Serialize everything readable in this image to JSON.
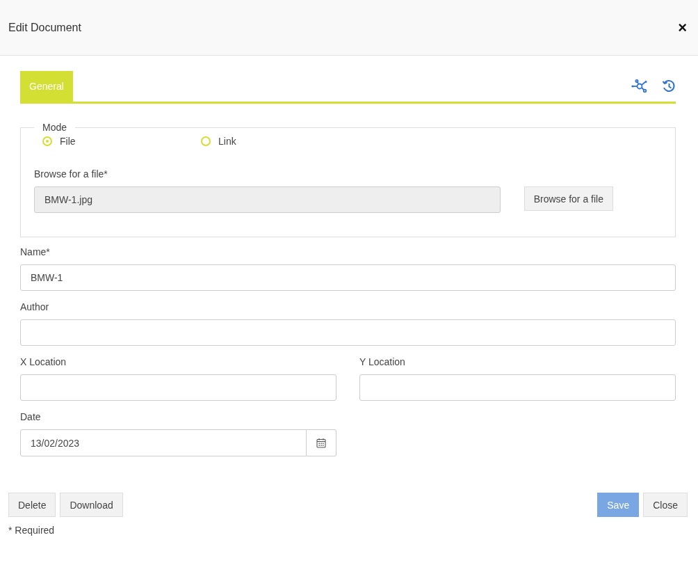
{
  "window": {
    "title": "Edit Document",
    "close_button": "×"
  },
  "tabs": [
    {
      "label": "General",
      "selected": true
    }
  ],
  "mode": {
    "legend": "Mode",
    "options": [
      {
        "label": "File",
        "selected": true
      },
      {
        "label": "Link",
        "selected": false
      }
    ],
    "file_label": "Browse for a file*",
    "file_value": "BMW-1.jpg",
    "browse_button": "Browse for a file"
  },
  "rows": [
    [
      {
        "kind": "text",
        "label": "Name*",
        "value": "BMW-1"
      }
    ],
    [
      {
        "kind": "text",
        "label": "Author"
      }
    ],
    [
      {
        "kind": "text",
        "label": "X Location"
      },
      {
        "kind": "text",
        "label": "Y Location"
      }
    ],
    [
      {
        "kind": "date",
        "label": "Date",
        "value": "13/02/2023"
      }
    ]
  ],
  "footer": {
    "left_buttons": [
      "Delete",
      "Download"
    ],
    "right_buttons": [
      {
        "label": "Save",
        "primary": true
      },
      {
        "label": "Close",
        "primary": false
      }
    ],
    "note": "* Required"
  }
}
